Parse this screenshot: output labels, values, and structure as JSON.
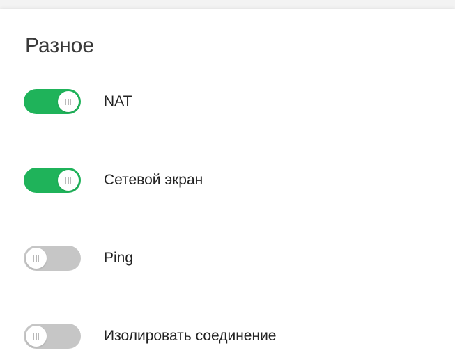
{
  "section": {
    "title": "Разное"
  },
  "toggles": [
    {
      "label": "NAT",
      "on": true
    },
    {
      "label": "Сетевой экран",
      "on": true
    },
    {
      "label": "Ping",
      "on": false
    },
    {
      "label": "Изолировать соединение",
      "on": false
    }
  ],
  "colors": {
    "toggle_on": "#1fb35a",
    "toggle_off": "#c6c6c6"
  }
}
